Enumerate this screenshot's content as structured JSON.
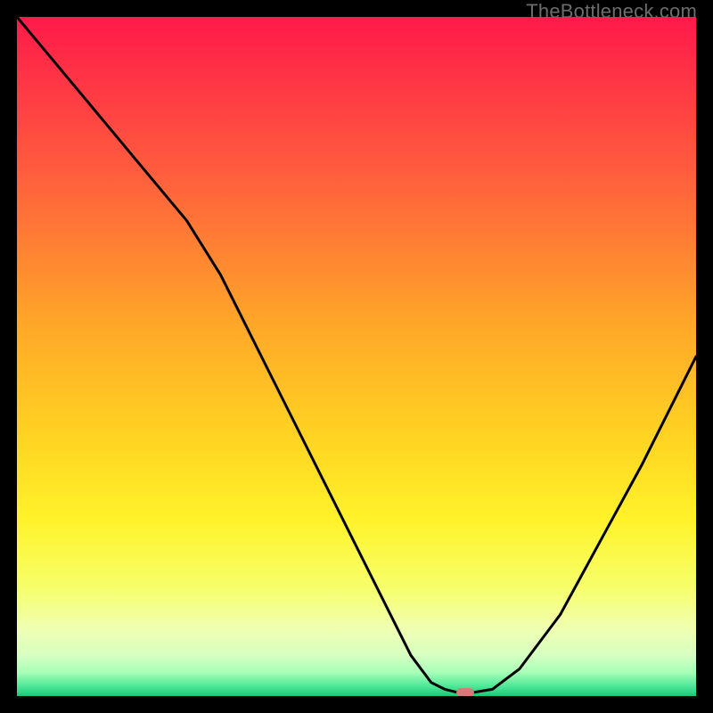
{
  "watermark": "TheBottleneck.com",
  "chart_data": {
    "type": "line",
    "xlim": [
      0,
      100
    ],
    "ylim": [
      0,
      100
    ],
    "background": {
      "type": "vertical-gradient",
      "stops": [
        {
          "pos": 0.0,
          "color": "#ff1a4a"
        },
        {
          "pos": 0.22,
          "color": "#ff5a3e"
        },
        {
          "pos": 0.45,
          "color": "#ffa628"
        },
        {
          "pos": 0.62,
          "color": "#ffd422"
        },
        {
          "pos": 0.74,
          "color": "#fff22a"
        },
        {
          "pos": 0.84,
          "color": "#f6ff6a"
        },
        {
          "pos": 0.9,
          "color": "#f0ffb0"
        },
        {
          "pos": 0.94,
          "color": "#d6ffc2"
        },
        {
          "pos": 0.965,
          "color": "#a8ffb8"
        },
        {
          "pos": 0.985,
          "color": "#50e898"
        },
        {
          "pos": 1.0,
          "color": "#18c978"
        }
      ]
    },
    "series": [
      {
        "name": "bottleneck-curve",
        "x": [
          0,
          5,
          10,
          15,
          20,
          25,
          30,
          35,
          40,
          45,
          50,
          55,
          58,
          61,
          63,
          65,
          67,
          70,
          74,
          80,
          86,
          92,
          100
        ],
        "values": [
          100,
          94,
          88,
          82,
          76,
          70,
          62,
          52,
          42,
          32,
          22,
          12,
          6,
          2,
          1,
          0.5,
          0.5,
          1,
          4,
          12,
          23,
          34,
          50
        ]
      }
    ],
    "marker": {
      "x": 66,
      "y": 0.5,
      "color": "#d87a7a",
      "shape": "pill"
    },
    "title": "",
    "xlabel": "",
    "ylabel": ""
  }
}
